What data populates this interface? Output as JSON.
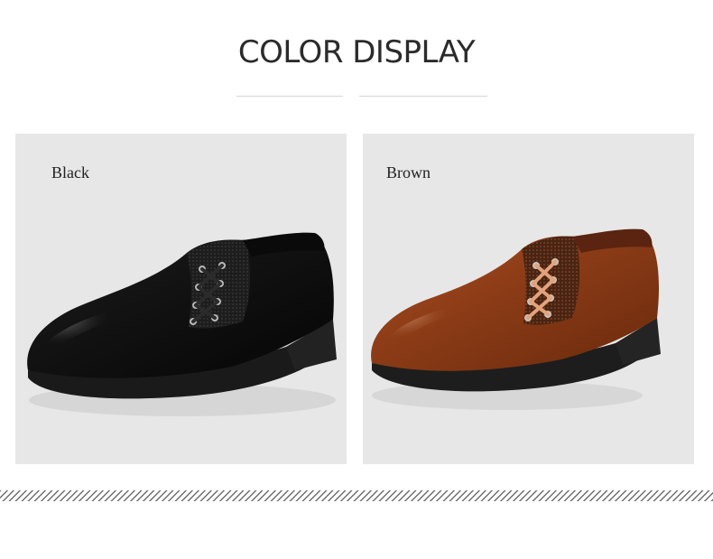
{
  "header": {
    "title": "COLOR DISPLAY"
  },
  "variants": [
    {
      "label": "Black",
      "color": "#111111"
    },
    {
      "label": "Brown",
      "color": "#8e3d17"
    }
  ]
}
